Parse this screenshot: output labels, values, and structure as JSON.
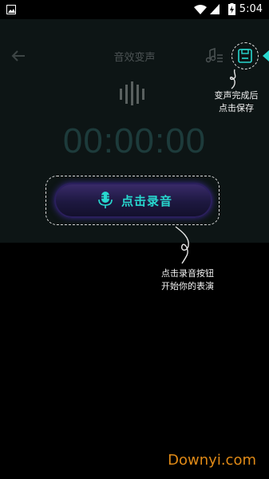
{
  "status_bar": {
    "time": "5:04"
  },
  "header": {
    "title": "音效变声"
  },
  "timer": {
    "value": "00:00:00"
  },
  "record": {
    "label": "点击录音"
  },
  "hints": {
    "save_line1": "变声完成后",
    "save_line2": "点击保存",
    "record_line1": "点击录音按钮",
    "record_line2": "开始你的表演"
  },
  "watermark": {
    "text": "Downyi.com"
  },
  "colors": {
    "accent": "#28d8cf",
    "button_bg": "#1d1840",
    "watermark": "#e08a17"
  }
}
